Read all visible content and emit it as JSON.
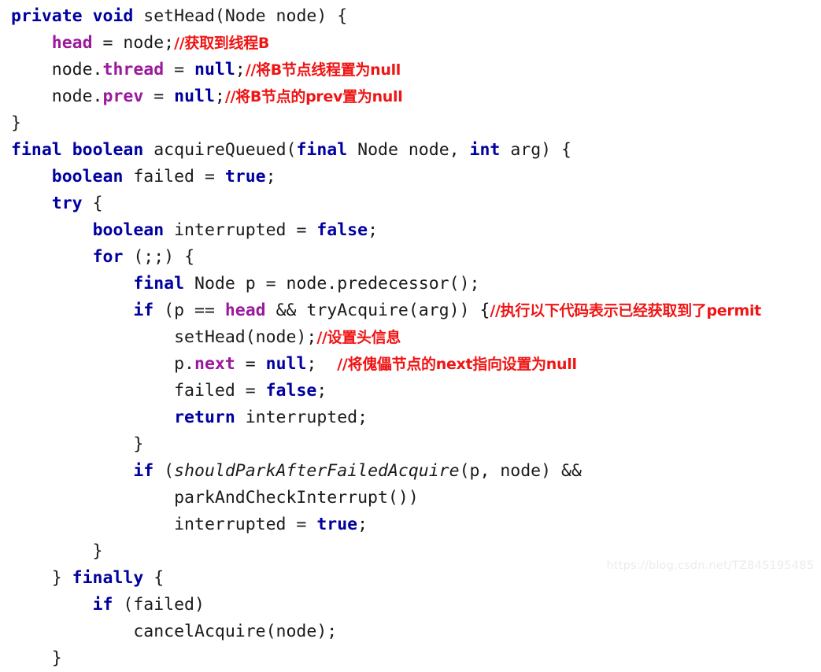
{
  "app": {
    "kind": "code-screenshot",
    "language": "Java",
    "theme": {
      "background": "#ffffff",
      "keyword": "#0000a0",
      "identifier": "#1a1a1a",
      "field": "#9b1a9b",
      "comment": "#f01414",
      "watermark": "#ececec"
    }
  },
  "watermark": {
    "text": "https://blog.csdn.net/TZ845195485"
  },
  "code": {
    "indent_unit": "    ",
    "lines": [
      {
        "n": 1,
        "indent": 0,
        "text": "private void setHead(Node node) {",
        "tokens": [
          {
            "t": "private",
            "c": "kw"
          },
          {
            "t": " ",
            "c": "plain"
          },
          {
            "t": "void",
            "c": "kw"
          },
          {
            "t": " setHead(Node node) {",
            "c": "plain"
          }
        ]
      },
      {
        "n": 2,
        "indent": 1,
        "text": "    head = node;//获取到线程B",
        "tokens": [
          {
            "t": "    ",
            "c": "plain"
          },
          {
            "t": "head",
            "c": "field"
          },
          {
            "t": " = node;",
            "c": "plain"
          },
          {
            "t": "//获取到线程B",
            "c": "comment"
          }
        ]
      },
      {
        "n": 3,
        "indent": 1,
        "text": "    node.thread = null;//将B节点线程置为null",
        "tokens": [
          {
            "t": "    node.",
            "c": "plain"
          },
          {
            "t": "thread",
            "c": "field"
          },
          {
            "t": " = ",
            "c": "plain"
          },
          {
            "t": "null",
            "c": "kw"
          },
          {
            "t": ";",
            "c": "plain"
          },
          {
            "t": "//将B节点线程置为null",
            "c": "comment"
          }
        ]
      },
      {
        "n": 4,
        "indent": 1,
        "text": "    node.prev = null;//将B节点的prev置为null",
        "tokens": [
          {
            "t": "    node.",
            "c": "plain"
          },
          {
            "t": "prev",
            "c": "field"
          },
          {
            "t": " = ",
            "c": "plain"
          },
          {
            "t": "null",
            "c": "kw"
          },
          {
            "t": ";",
            "c": "plain"
          },
          {
            "t": "//将B节点的prev置为null",
            "c": "comment"
          }
        ]
      },
      {
        "n": 5,
        "indent": 0,
        "text": "}",
        "tokens": [
          {
            "t": "}",
            "c": "plain"
          }
        ]
      },
      {
        "n": 6,
        "indent": 0,
        "text": "final boolean acquireQueued(final Node node, int arg) {",
        "tokens": [
          {
            "t": "final",
            "c": "kw"
          },
          {
            "t": " ",
            "c": "plain"
          },
          {
            "t": "boolean",
            "c": "kw"
          },
          {
            "t": " acquireQueued(",
            "c": "plain"
          },
          {
            "t": "final",
            "c": "kw"
          },
          {
            "t": " Node node, ",
            "c": "plain"
          },
          {
            "t": "int",
            "c": "kw"
          },
          {
            "t": " arg) {",
            "c": "plain"
          }
        ]
      },
      {
        "n": 7,
        "indent": 1,
        "text": "    boolean failed = true;",
        "tokens": [
          {
            "t": "    ",
            "c": "plain"
          },
          {
            "t": "boolean",
            "c": "kw"
          },
          {
            "t": " failed = ",
            "c": "plain"
          },
          {
            "t": "true",
            "c": "kw"
          },
          {
            "t": ";",
            "c": "plain"
          }
        ]
      },
      {
        "n": 8,
        "indent": 1,
        "text": "    try {",
        "tokens": [
          {
            "t": "    ",
            "c": "plain"
          },
          {
            "t": "try",
            "c": "kw"
          },
          {
            "t": " {",
            "c": "plain"
          }
        ]
      },
      {
        "n": 9,
        "indent": 2,
        "text": "        boolean interrupted = false;",
        "tokens": [
          {
            "t": "        ",
            "c": "plain"
          },
          {
            "t": "boolean",
            "c": "kw"
          },
          {
            "t": " interrupted = ",
            "c": "plain"
          },
          {
            "t": "false",
            "c": "kw"
          },
          {
            "t": ";",
            "c": "plain"
          }
        ]
      },
      {
        "n": 10,
        "indent": 2,
        "text": "        for (;;) {",
        "tokens": [
          {
            "t": "        ",
            "c": "plain"
          },
          {
            "t": "for",
            "c": "kw"
          },
          {
            "t": " (;;) {",
            "c": "plain"
          }
        ]
      },
      {
        "n": 11,
        "indent": 3,
        "text": "            final Node p = node.predecessor();",
        "tokens": [
          {
            "t": "            ",
            "c": "plain"
          },
          {
            "t": "final",
            "c": "kw"
          },
          {
            "t": " Node p = node.predecessor();",
            "c": "plain"
          }
        ]
      },
      {
        "n": 12,
        "indent": 3,
        "text": "            if (p == head && tryAcquire(arg)) {//执行以下代码表示已经获取到了permit",
        "tokens": [
          {
            "t": "            ",
            "c": "plain"
          },
          {
            "t": "if",
            "c": "kw"
          },
          {
            "t": " (p == ",
            "c": "plain"
          },
          {
            "t": "head",
            "c": "field"
          },
          {
            "t": " && tryAcquire(arg)) {",
            "c": "plain"
          },
          {
            "t": "//执行以下代码表示已经获取到了permit",
            "c": "comment"
          }
        ]
      },
      {
        "n": 13,
        "indent": 4,
        "text": "                setHead(node);//设置头信息",
        "tokens": [
          {
            "t": "                setHead(node);",
            "c": "plain"
          },
          {
            "t": "//设置头信息",
            "c": "comment"
          }
        ]
      },
      {
        "n": 14,
        "indent": 4,
        "text": "                p.next = null;  //将傀儡节点的next指向设置为null",
        "tokens": [
          {
            "t": "                p.",
            "c": "plain"
          },
          {
            "t": "next",
            "c": "field"
          },
          {
            "t": " = ",
            "c": "plain"
          },
          {
            "t": "null",
            "c": "kw"
          },
          {
            "t": ";  ",
            "c": "plain"
          },
          {
            "t": "//将傀儡节点的next指向设置为null",
            "c": "comment"
          }
        ]
      },
      {
        "n": 15,
        "indent": 4,
        "text": "                failed = false;",
        "tokens": [
          {
            "t": "                failed = ",
            "c": "plain"
          },
          {
            "t": "false",
            "c": "kw"
          },
          {
            "t": ";",
            "c": "plain"
          }
        ]
      },
      {
        "n": 16,
        "indent": 4,
        "text": "                return interrupted;",
        "tokens": [
          {
            "t": "                ",
            "c": "plain"
          },
          {
            "t": "return",
            "c": "kw"
          },
          {
            "t": " interrupted;",
            "c": "plain"
          }
        ]
      },
      {
        "n": 17,
        "indent": 3,
        "text": "            }",
        "tokens": [
          {
            "t": "            }",
            "c": "plain"
          }
        ]
      },
      {
        "n": 18,
        "indent": 3,
        "text": "            if (shouldParkAfterFailedAcquire(p, node) &&",
        "tokens": [
          {
            "t": "            ",
            "c": "plain"
          },
          {
            "t": "if",
            "c": "kw"
          },
          {
            "t": " (",
            "c": "plain"
          },
          {
            "t": "shouldParkAfterFailedAcquire",
            "c": "method-italic"
          },
          {
            "t": "(p, node) &&",
            "c": "plain"
          }
        ]
      },
      {
        "n": 19,
        "indent": 4,
        "text": "                parkAndCheckInterrupt())",
        "tokens": [
          {
            "t": "                parkAndCheckInterrupt())",
            "c": "plain"
          }
        ]
      },
      {
        "n": 20,
        "indent": 4,
        "text": "                interrupted = true;",
        "tokens": [
          {
            "t": "                interrupted = ",
            "c": "plain"
          },
          {
            "t": "true",
            "c": "kw"
          },
          {
            "t": ";",
            "c": "plain"
          }
        ]
      },
      {
        "n": 21,
        "indent": 2,
        "text": "        }",
        "tokens": [
          {
            "t": "        }",
            "c": "plain"
          }
        ]
      },
      {
        "n": 22,
        "indent": 1,
        "text": "    } finally {",
        "tokens": [
          {
            "t": "    } ",
            "c": "plain"
          },
          {
            "t": "finally",
            "c": "kw"
          },
          {
            "t": " {",
            "c": "plain"
          }
        ]
      },
      {
        "n": 23,
        "indent": 2,
        "text": "        if (failed)",
        "tokens": [
          {
            "t": "        ",
            "c": "plain"
          },
          {
            "t": "if",
            "c": "kw"
          },
          {
            "t": " (failed)",
            "c": "plain"
          }
        ]
      },
      {
        "n": 24,
        "indent": 3,
        "text": "            cancelAcquire(node);",
        "tokens": [
          {
            "t": "            cancelAcquire(node);",
            "c": "plain"
          }
        ]
      },
      {
        "n": 25,
        "indent": 1,
        "clipped": true,
        "text": "    }",
        "tokens": [
          {
            "t": "    }",
            "c": "plain"
          }
        ]
      }
    ]
  }
}
